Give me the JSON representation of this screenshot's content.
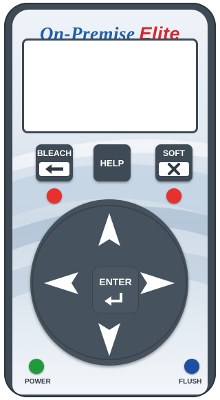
{
  "brand": {
    "name": "On-Premise",
    "suffix": "Elite"
  },
  "buttons": {
    "bleach": {
      "label": "BLEACH",
      "icon": "arrow-left-icon",
      "indicator_color": "#e8302c"
    },
    "help": {
      "label": "HELP"
    },
    "soft": {
      "label": "SOFT",
      "icon": "x-icon",
      "indicator_color": "#e8302c"
    },
    "up": {
      "icon": "arrow-up-icon"
    },
    "down": {
      "icon": "arrow-down-icon"
    },
    "left": {
      "icon": "arrow-left-icon"
    },
    "right": {
      "icon": "arrow-right-icon"
    },
    "enter": {
      "label": "ENTER",
      "icon": "enter-return-icon"
    }
  },
  "indicators": {
    "power": {
      "label": "POWER",
      "color": "#1f9b3d"
    },
    "flush": {
      "label": "FLUSH",
      "color": "#1e4fa3"
    }
  },
  "display": {
    "text": ""
  },
  "colors": {
    "panel": "#3e4a55",
    "brand_blue": "#1f5fae",
    "brand_red": "#d9262c"
  }
}
